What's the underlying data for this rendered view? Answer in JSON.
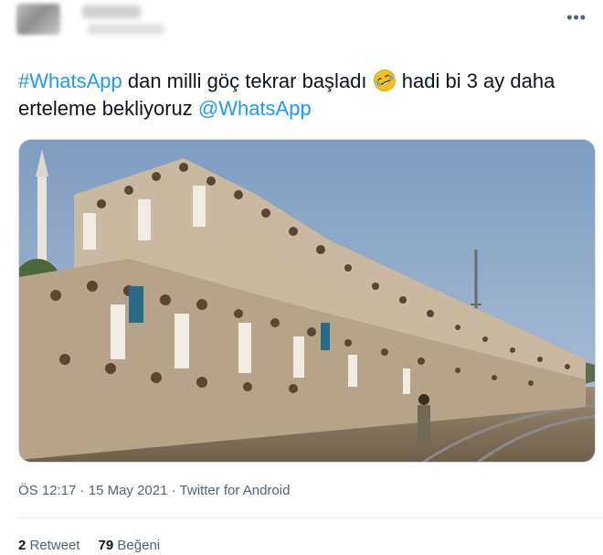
{
  "tweet": {
    "text_parts": {
      "hashtag": "#WhatsApp",
      "text1": " dan milli göç tekrar başladı ",
      "emoji_name": "rolling-on-floor-laughing-emoji",
      "text2": " hadi bi 3 ay daha erteleme bekliyoruz ",
      "mention": "@WhatsApp"
    },
    "photo_description_icon": "train-crowd-photo"
  },
  "meta": {
    "time": "ÖS 12:17",
    "separator1": " · ",
    "date": "15 May 2021",
    "separator2": " · ",
    "source": "Twitter for Android"
  },
  "stats": {
    "retweets_count": "2",
    "retweets_label": "Retweet",
    "likes_count": "79",
    "likes_label": "Beğeni"
  },
  "colors": {
    "link": "#1d9bf0",
    "secondary_text": "#536471",
    "sky": "#8fa9c8"
  }
}
